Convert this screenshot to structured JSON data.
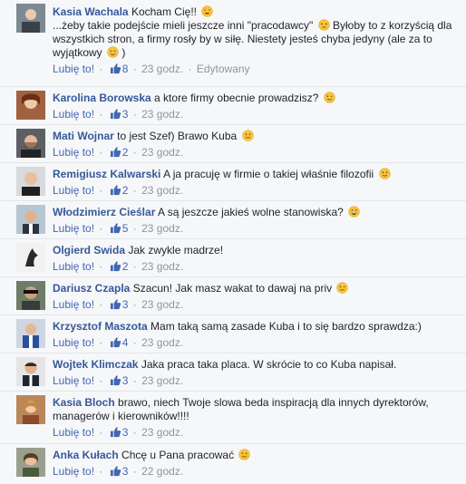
{
  "colors": {
    "link": "#365899",
    "action": "#4267b2",
    "meta": "#90949c",
    "background": "#f6f7f9"
  },
  "like_label": "Lubię to!",
  "comments": [
    {
      "author": "Kasia Wachala",
      "text": "Kocham Cię!!",
      "text_emoji": "heart-eyes-emoji",
      "text2": "...żeby takie podejście mieli jeszcze inni \"pracodawcy\"",
      "text2_emoji": "unamused-emoji",
      "text3": "Byłoby to z korzyścią dla wszystkich stron, a firmy rosły by w siłę. Niestety jesteś chyba jedyny (ale za to wyjątkowy",
      "text3_emoji": "blush-emoji",
      "text3_end": ")",
      "likes": "8",
      "time": "23 godz.",
      "edited": "Edytowany"
    },
    {
      "author": "Karolina Borowska",
      "text": "a ktore firmy obecnie prowadzisz?",
      "emoji": "wink-emoji",
      "likes": "3",
      "time": "23 godz."
    },
    {
      "author": "Mati Wojnar",
      "text": "to jest Szef) Brawo Kuba",
      "emoji": "smile-emoji",
      "likes": "2",
      "time": "23 godz."
    },
    {
      "author": "Remigiusz Kalwarski",
      "text": "A ja pracuję w firmie o takiej właśnie filozofii",
      "emoji": "smile-emoji",
      "likes": "2",
      "time": "23 godz."
    },
    {
      "author": "Włodzimierz Cieślar",
      "text": "A są jeszcze jakieś wolne stanowiska?",
      "emoji": "grin-emoji",
      "likes": "5",
      "time": "23 godz."
    },
    {
      "author": "Olgierd Swida",
      "text": "Jak zwykle madrze!",
      "emoji": "",
      "likes": "2",
      "time": "23 godz."
    },
    {
      "author": "Dariusz Czapla",
      "text": "Szacun! Jak masz wakat to dawaj na priv",
      "emoji": "wink-emoji",
      "likes": "3",
      "time": "23 godz."
    },
    {
      "author": "Krzysztof Maszota",
      "text": "Mam taką samą zasade Kuba i to się bardzo sprawdza:)",
      "emoji": "",
      "likes": "4",
      "time": "23 godz."
    },
    {
      "author": "Wojtek Klimczak",
      "text": "Jaka praca taka placa. W skrócie to co Kuba napisał.",
      "emoji": "",
      "likes": "3",
      "time": "23 godz."
    },
    {
      "author": "Kasia Bloch",
      "text": "brawo, niech Twoje slowa beda inspiracją dla innych dyrektorów, managerów i kierowników!!!!",
      "emoji": "",
      "likes": "3",
      "time": "23 godz."
    },
    {
      "author": "Anka Kułach",
      "text": "Chcę u Pana pracować",
      "emoji": "smile-emoji",
      "likes": "3",
      "time": "22 godz."
    }
  ]
}
